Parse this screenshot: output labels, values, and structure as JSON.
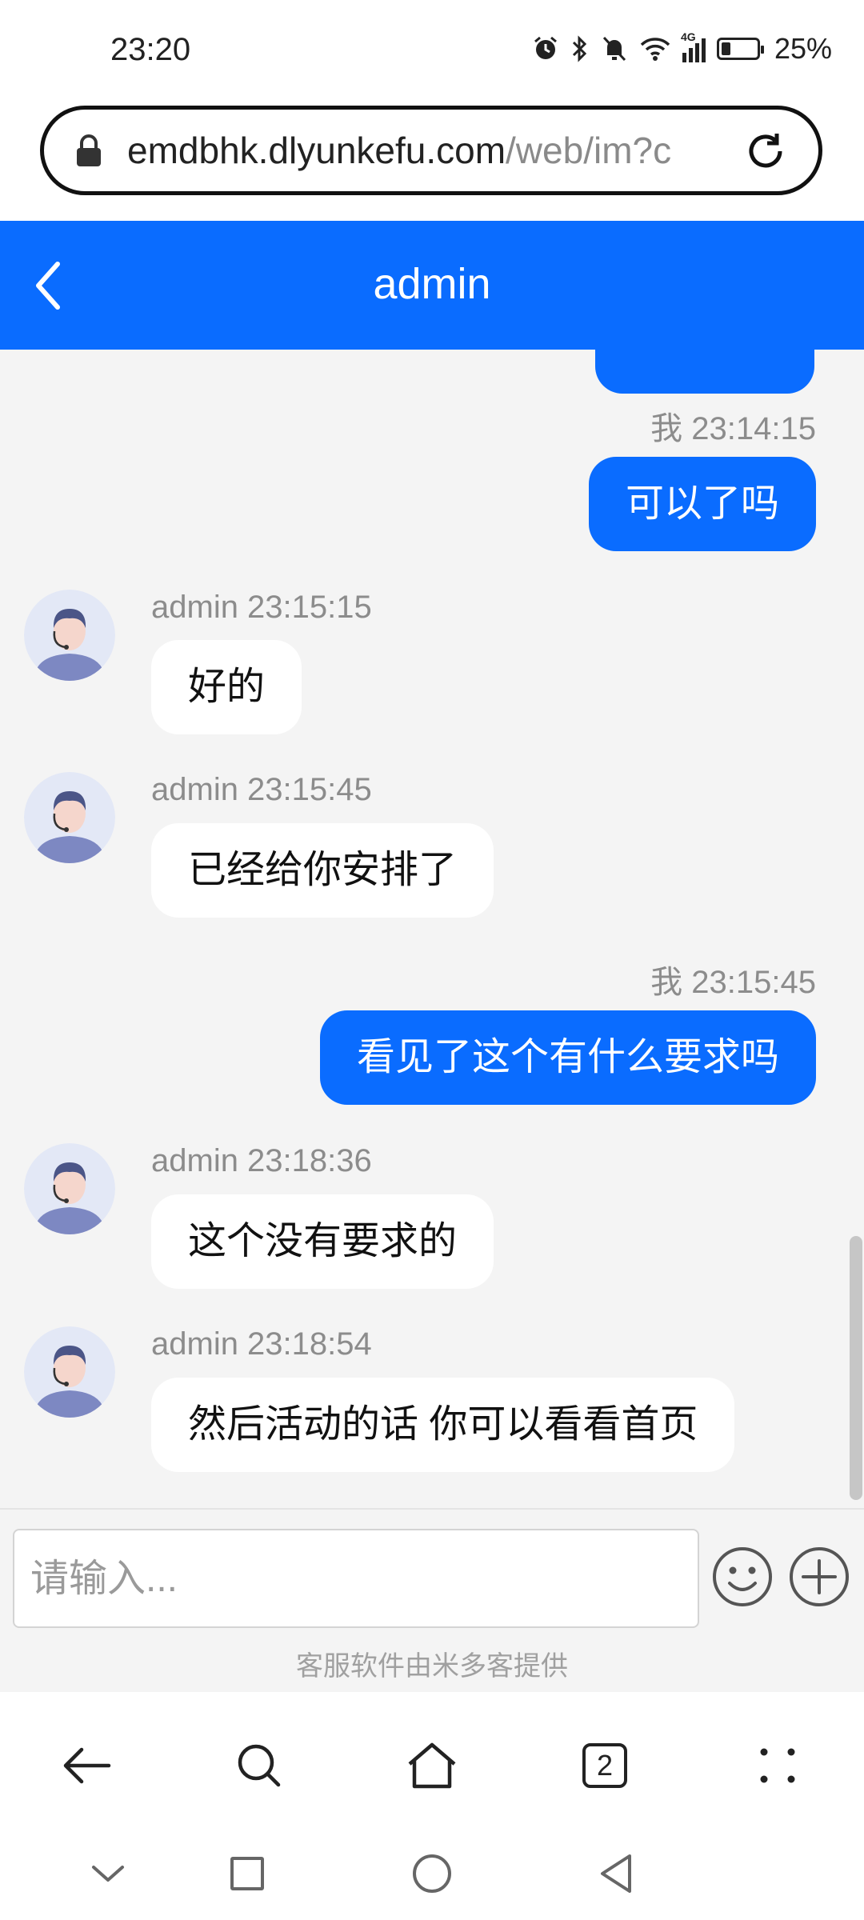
{
  "status_bar": {
    "time": "23:20",
    "network_label": "4G",
    "battery": "25%"
  },
  "url_bar": {
    "domain": "emdbhk.dlyunkefu.com",
    "path": "/web/im?c"
  },
  "header": {
    "title": "admin"
  },
  "messages": [
    {
      "direction": "out",
      "meta": "我 23:14:15",
      "text": "可以了吗"
    },
    {
      "direction": "in",
      "meta": "admin 23:15:15",
      "text": "好的"
    },
    {
      "direction": "in",
      "meta": "admin 23:15:45",
      "text": "已经给你安排了"
    },
    {
      "direction": "out",
      "meta": "我 23:15:45",
      "text": "看见了这个有什么要求吗"
    },
    {
      "direction": "in",
      "meta": "admin 23:18:36",
      "text": "这个没有要求的"
    },
    {
      "direction": "in",
      "meta": "admin 23:18:54",
      "text": "然后活动的话 你可以看看首页"
    }
  ],
  "input": {
    "placeholder": "请输入...",
    "value": ""
  },
  "footer": {
    "powered_by": "客服软件由米多客提供"
  },
  "browser_nav": {
    "tab_count": "2"
  },
  "colors": {
    "accent": "#0a6cff",
    "chat_bg": "#f4f4f4",
    "meta_text": "#8c8c8c"
  },
  "icons": [
    "lock-icon",
    "reload-icon",
    "back-icon",
    "avatar",
    "emoji-icon",
    "plus-icon",
    "nav-back-icon",
    "search-icon",
    "home-icon",
    "tabs-icon",
    "menu-icon",
    "collapse-icon",
    "recents-icon",
    "home-circle-icon",
    "system-back-icon"
  ]
}
